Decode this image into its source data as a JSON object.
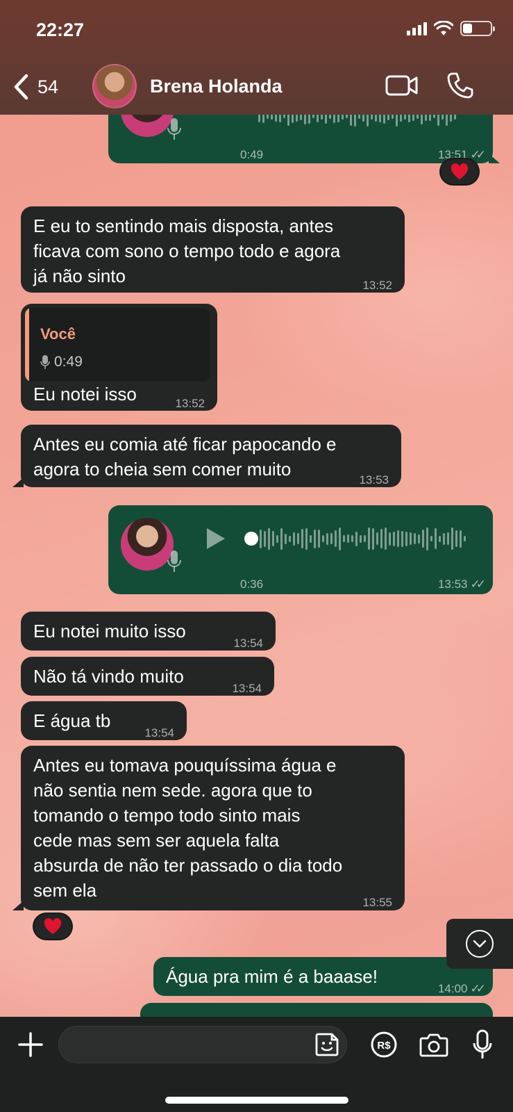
{
  "status": {
    "time": "22:27",
    "battery_level": 0.35
  },
  "header": {
    "back_count": "54",
    "contact_name": "Brena Holanda"
  },
  "messages": [
    {
      "id": "m0",
      "direction": "out",
      "type": "voice",
      "duration": "0:49",
      "time": "13:51",
      "reaction": "heart"
    },
    {
      "id": "m1",
      "direction": "in",
      "type": "text",
      "lines": [
        "E eu to sentindo mais disposta, antes",
        "ficava com sono o tempo todo e agora",
        "já não sinto"
      ],
      "time": "13:52"
    },
    {
      "id": "m2",
      "direction": "in",
      "type": "reply",
      "quote_author": "Você",
      "quote_duration": "0:49",
      "text": "Eu notei isso",
      "time": "13:52"
    },
    {
      "id": "m3",
      "direction": "in",
      "type": "text",
      "lines": [
        "Antes eu comia até ficar papocando e",
        "agora to cheia sem comer muito"
      ],
      "time": "13:53"
    },
    {
      "id": "m4",
      "direction": "out",
      "type": "voice",
      "duration": "0:36",
      "time": "13:53"
    },
    {
      "id": "m5",
      "direction": "in",
      "type": "text",
      "lines": [
        "Eu notei muito isso"
      ],
      "time": "13:54"
    },
    {
      "id": "m6",
      "direction": "in",
      "type": "text",
      "lines": [
        "Não tá vindo muito"
      ],
      "time": "13:54"
    },
    {
      "id": "m7",
      "direction": "in",
      "type": "text",
      "lines": [
        "E água tb"
      ],
      "time": "13:54"
    },
    {
      "id": "m8",
      "direction": "in",
      "type": "text",
      "lines": [
        "Antes eu tomava pouquíssima água e",
        "não sentia nem sede. agora que to",
        "tomando o tempo todo sinto mais",
        "cede mas sem ser aquela falta",
        "absurda de não ter passado o dia todo",
        "sem ela"
      ],
      "time": "13:55",
      "reaction": "heart"
    },
    {
      "id": "m9",
      "direction": "out",
      "type": "text",
      "lines": [
        "Água pra mim é a baaase!"
      ],
      "time": "14:00"
    }
  ],
  "input": {
    "placeholder": ""
  },
  "icons": {
    "back": "chevron-left-icon",
    "video": "video-camera-icon",
    "call": "phone-icon",
    "plus": "plus-icon",
    "sticker": "sticker-icon",
    "pay": "payment-icon",
    "camera": "camera-icon",
    "mic": "microphone-icon",
    "reaction": "heart-icon"
  },
  "colors": {
    "incoming_bubble": "#242626",
    "outgoing_bubble": "#144d37",
    "quote_accent": "#f59b7a",
    "heart": "#e0142e"
  }
}
